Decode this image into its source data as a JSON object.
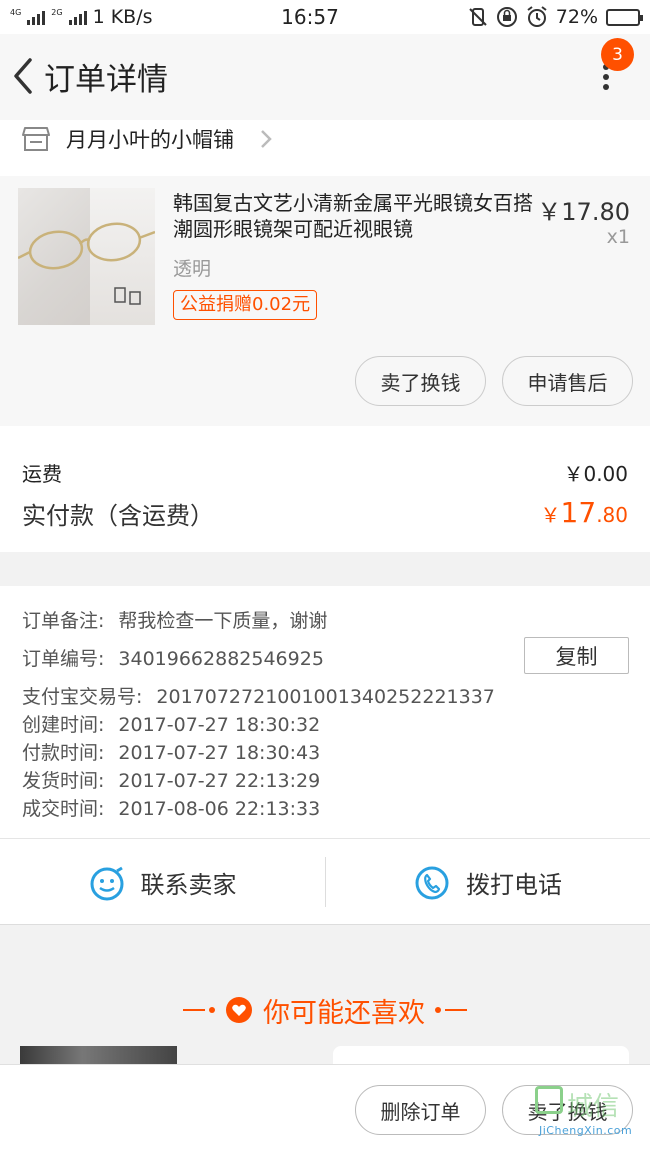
{
  "status_bar": {
    "network_a": "4G",
    "network_b": "2G",
    "speed": "1 KB/s",
    "time": "16:57",
    "battery": "72%",
    "battery_level": 0.72
  },
  "header": {
    "title": "订单详情",
    "notification_count": "3"
  },
  "shop": {
    "name": "月月小叶的小帽铺"
  },
  "product": {
    "name": "韩国复古文艺小清新金属平光眼镜女百搭潮圆形眼镜架可配近视眼镜",
    "price": "￥17.80",
    "quantity": "x1",
    "sku": "透明",
    "charity_tag": "公益捐赠0.02元",
    "btn_sell": "卖了换钱",
    "btn_after_sale": "申请售后"
  },
  "costs": {
    "freight_label": "运费",
    "freight_value": "￥0.00",
    "paid_label": "实付款（含运费）",
    "paid_currency": "￥",
    "paid_int": "17",
    "paid_dec": ".80"
  },
  "order_info": {
    "note_label": "订单备注:",
    "note_value": "帮我检查一下质量，谢谢",
    "order_no_label": "订单编号:",
    "order_no_value": "34019662882546925",
    "copy_label": "复制",
    "alipay_label": "支付宝交易号:",
    "alipay_value": "2017072721001001340252221337",
    "created_label": "创建时间:",
    "created_value": "2017-07-27 18:30:32",
    "paid_label": "付款时间:",
    "paid_value": "2017-07-27 18:30:43",
    "shipped_label": "发货时间:",
    "shipped_value": "2017-07-27 22:13:29",
    "done_label": "成交时间:",
    "done_value": "2017-08-06 22:13:33"
  },
  "contact": {
    "seller_label": "联系卖家",
    "phone_label": "拨打电话"
  },
  "recommend": {
    "title": "你可能还喜欢"
  },
  "bottom": {
    "delete_label": "删除订单",
    "sell_label": "卖了换钱"
  },
  "watermark": {
    "text": "城信",
    "sub": "JiChengXin.com"
  },
  "colors": {
    "accent": "#ff5000",
    "icon_blue": "#29a0e0"
  }
}
